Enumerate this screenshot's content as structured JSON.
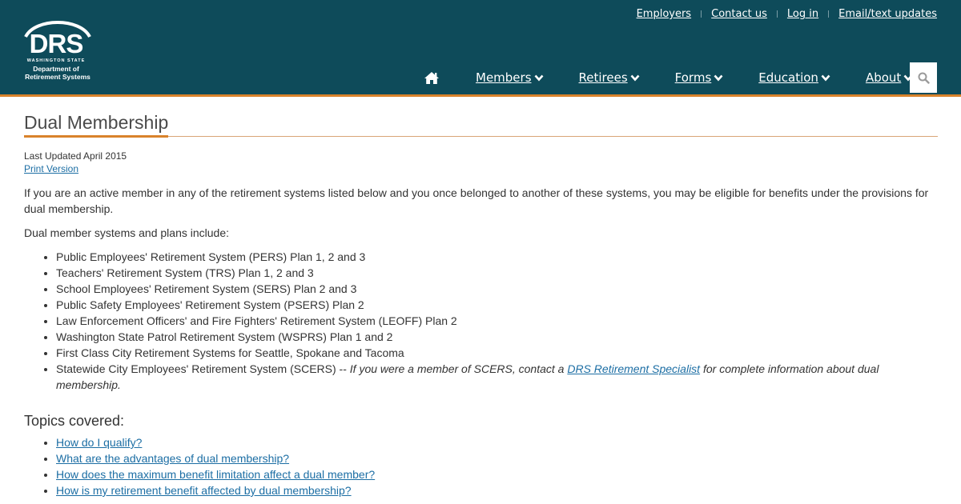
{
  "header": {
    "logo": {
      "letters": "DRS",
      "state": "WASHINGTON STATE",
      "department": "Department of",
      "systems": "Retirement Systems"
    },
    "utility_links": [
      "Employers",
      "Contact us",
      "Log in",
      "Email/text updates"
    ],
    "utility_separator": "|",
    "nav": [
      "Members",
      "Retirees",
      "Forms",
      "Education",
      "About"
    ],
    "icons": {
      "home": "home-icon",
      "chevron": "chevron-down-icon",
      "search": "search-icon"
    },
    "colors": {
      "header_bg": "#0e4b5a",
      "accent": "#d9822b",
      "link": "#1c6ea4"
    }
  },
  "page": {
    "title": "Dual Membership",
    "last_updated": "Last Updated April 2015",
    "print_version": "Print Version",
    "intro": "If you are an active member in any of the retirement systems listed below and you once belonged to another of these systems, you may be eligible for benefits under the provisions for dual membership.",
    "plans_lead": "Dual member systems and plans include:",
    "plans": [
      "Public Employees' Retirement System (PERS) Plan 1, 2 and 3",
      "Teachers' Retirement System (TRS) Plan 1, 2 and 3",
      "School Employees' Retirement System (SERS) Plan 2 and 3",
      "Public Safety Employees' Retirement System (PSERS) Plan 2",
      "Law Enforcement Officers' and Fire Fighters' Retirement System (LEOFF) Plan 2",
      "Washington State Patrol Retirement System (WSPRS) Plan 1 and 2",
      "First Class City Retirement Systems for Seattle, Spokane and Tacoma"
    ],
    "scers": {
      "prefix": "Statewide City Employees' Retirement System (SCERS) -- ",
      "italic_before": "If you were a member of SCERS, contact a ",
      "link": "DRS Retirement Specialist",
      "italic_after": " for complete information about dual membership."
    },
    "topics_heading": "Topics covered:",
    "topics": [
      "How do I qualify?",
      "What are the advantages of dual membership?",
      "How does the maximum benefit limitation affect a dual member?",
      "How is my retirement benefit affected by dual membership?"
    ]
  }
}
